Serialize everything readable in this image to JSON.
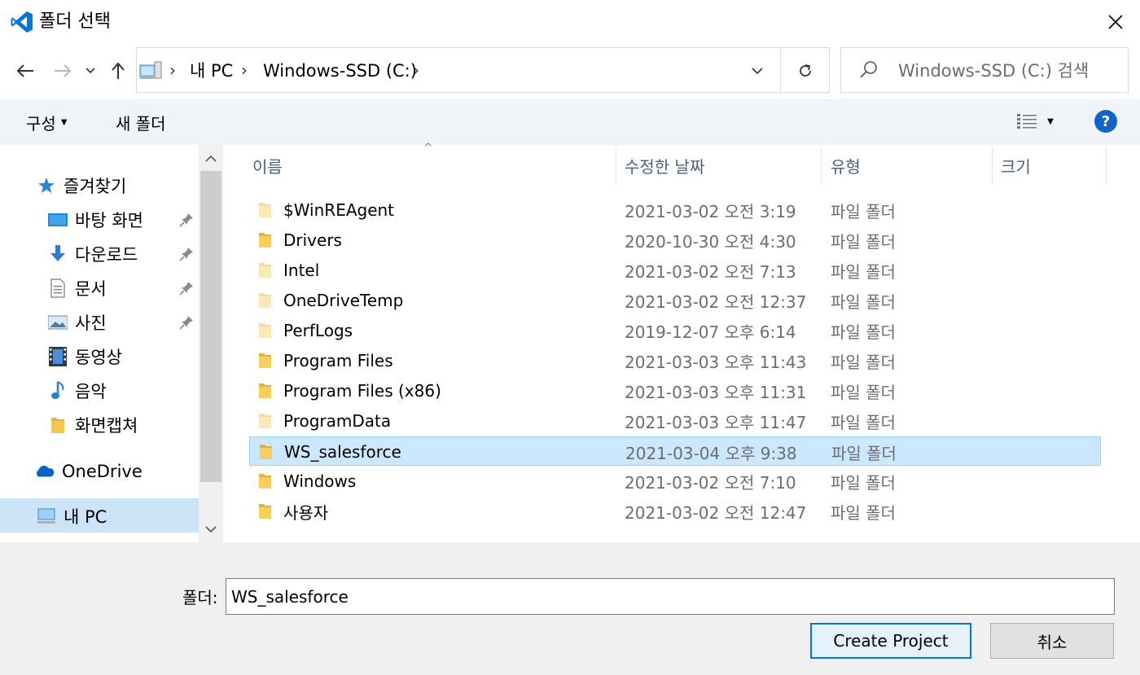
{
  "window": {
    "title": "폴더 선택",
    "accent": "#0078d7"
  },
  "nav": {
    "back_icon": "arrow-left-icon",
    "forward_icon": "arrow-right-icon",
    "recent_icon": "chevron-down-icon",
    "up_icon": "arrow-up-icon",
    "breadcrumb": [
      "내 PC",
      "Windows-SSD (C:)"
    ],
    "search_placeholder": "Windows-SSD (C:) 검색"
  },
  "toolbar": {
    "organize_label": "구성",
    "new_folder_label": "새 폴더",
    "help_label": "?"
  },
  "sidebar": {
    "items": [
      {
        "label": "즐겨찾기",
        "icon": "star-icon",
        "pinned": false
      },
      {
        "label": "바탕 화면",
        "icon": "desktop-icon",
        "pinned": true
      },
      {
        "label": "다운로드",
        "icon": "download-icon",
        "pinned": true
      },
      {
        "label": "문서",
        "icon": "document-icon",
        "pinned": true
      },
      {
        "label": "사진",
        "icon": "picture-icon",
        "pinned": true
      },
      {
        "label": "동영상",
        "icon": "video-icon",
        "pinned": false
      },
      {
        "label": "음악",
        "icon": "music-icon",
        "pinned": false
      },
      {
        "label": "화면캡쳐",
        "icon": "folder-icon",
        "pinned": false
      },
      {
        "label": "OneDrive",
        "icon": "cloud-icon",
        "pinned": false
      },
      {
        "label": "내 PC",
        "icon": "computer-icon",
        "pinned": false,
        "selected": true
      }
    ]
  },
  "file_list": {
    "columns": [
      "이름",
      "수정한 날짜",
      "유형",
      "크기"
    ],
    "rows": [
      {
        "name": "$WinREAgent",
        "date": "2021-03-02 오전 3:19",
        "type": "파일 폴더",
        "faded": true
      },
      {
        "name": "Drivers",
        "date": "2020-10-30 오전 4:30",
        "type": "파일 폴더"
      },
      {
        "name": "Intel",
        "date": "2021-03-02 오전 7:13",
        "type": "파일 폴더",
        "faded": true
      },
      {
        "name": "OneDriveTemp",
        "date": "2021-03-02 오전 12:37",
        "type": "파일 폴더",
        "faded": true
      },
      {
        "name": "PerfLogs",
        "date": "2019-12-07 오후 6:14",
        "type": "파일 폴더",
        "faded": true
      },
      {
        "name": "Program Files",
        "date": "2021-03-03 오후 11:43",
        "type": "파일 폴더"
      },
      {
        "name": "Program Files (x86)",
        "date": "2021-03-03 오후 11:31",
        "type": "파일 폴더"
      },
      {
        "name": "ProgramData",
        "date": "2021-03-03 오후 11:47",
        "type": "파일 폴더",
        "faded": true
      },
      {
        "name": "WS_salesforce",
        "date": "2021-03-04 오후 9:38",
        "type": "파일 폴더",
        "selected": true
      },
      {
        "name": "Windows",
        "date": "2021-03-02 오전 7:10",
        "type": "파일 폴더"
      },
      {
        "name": "사용자",
        "date": "2021-03-02 오전 12:47",
        "type": "파일 폴더"
      }
    ]
  },
  "footer": {
    "folder_label": "폴더:",
    "folder_value": "WS_salesforce",
    "confirm_label": "Create Project",
    "cancel_label": "취소"
  }
}
